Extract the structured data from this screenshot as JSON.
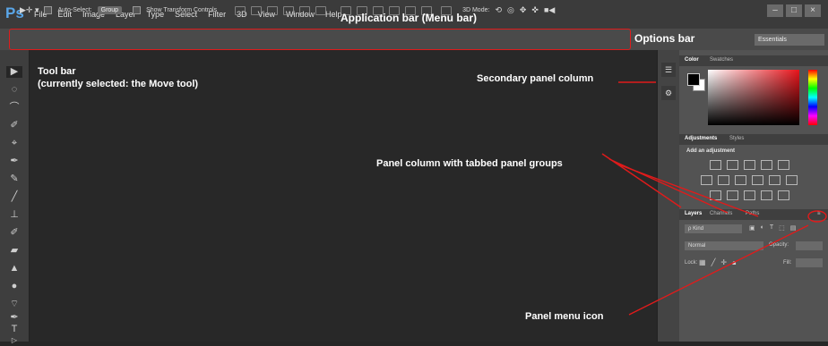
{
  "app": {
    "logo": "Ps"
  },
  "menu": {
    "items": [
      "File",
      "Edit",
      "Image",
      "Layer",
      "Type",
      "Select",
      "Filter",
      "3D",
      "View",
      "Window",
      "Help"
    ]
  },
  "window_controls": [
    "–",
    "□",
    "×"
  ],
  "options": {
    "auto_select": "Auto-Select:",
    "group": "Group",
    "show_transform": "Show Transform Controls",
    "mode_3d": "3D Mode:",
    "workspace": "Essentials"
  },
  "panels": {
    "color_tabs": [
      "Color",
      "Swatches"
    ],
    "adjust_tabs": [
      "Adjustments",
      "Styles"
    ],
    "add_adjustment": "Add an adjustment",
    "layers_tabs": [
      "Layers",
      "Channels",
      "Paths"
    ],
    "kind": "ρ Kind",
    "blend_mode": "Normal",
    "opacity_label": "Opacity:",
    "lock_label": "Lock:",
    "fill_label": "Fill:"
  },
  "annotations": {
    "app_bar": "Application bar (Menu bar)",
    "options_bar": "Options bar",
    "tool_bar": "Tool bar",
    "tool_bar_note": "(currently selected: the Move tool)",
    "secondary_panel": "Secondary panel column",
    "panel_column": "Panel column with tabbed panel groups",
    "panel_menu_icon": "Panel menu icon"
  },
  "colors": {
    "annotation_line": "#e01b1b",
    "logo": "#5aa6e8"
  }
}
